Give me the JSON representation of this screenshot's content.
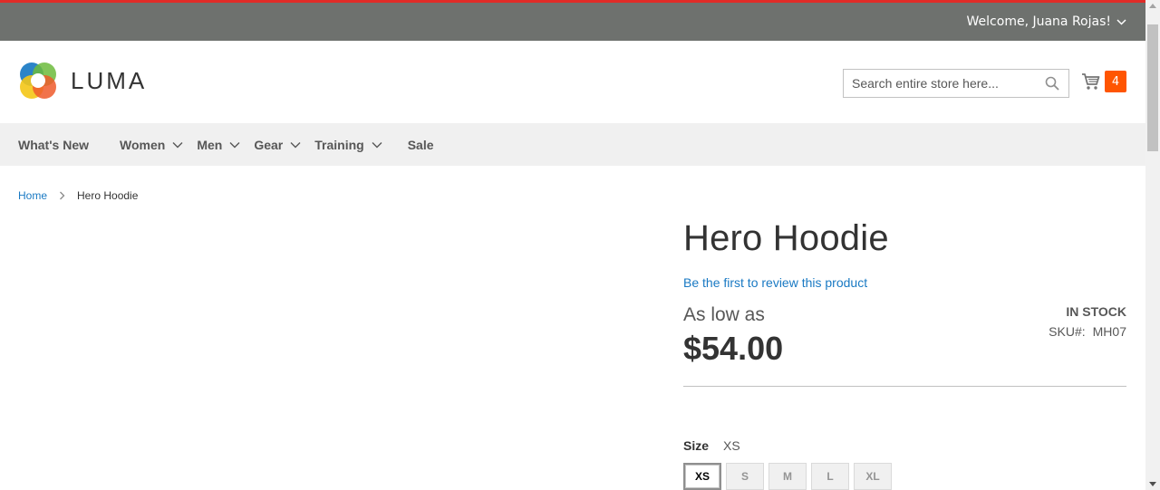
{
  "colors": {
    "accent": "#e02b27",
    "link": "#1979c3",
    "cart_badge": "#ff5501",
    "panel": "#6e716e"
  },
  "header": {
    "welcome": "Welcome, Juana Rojas!",
    "logo_text": "LUMA",
    "search_placeholder": "Search entire store here...",
    "cart_count": "4",
    "icons": {
      "account_toggle": "chevron-down-icon",
      "search": "search-icon",
      "cart": "cart-icon"
    }
  },
  "nav": {
    "items": [
      {
        "label": "What's New",
        "has_submenu": false
      },
      {
        "label": "Women",
        "has_submenu": true
      },
      {
        "label": "Men",
        "has_submenu": true
      },
      {
        "label": "Gear",
        "has_submenu": true
      },
      {
        "label": "Training",
        "has_submenu": true
      },
      {
        "label": "Sale",
        "has_submenu": false
      }
    ]
  },
  "breadcrumbs": {
    "home": "Home",
    "current": "Hero Hoodie"
  },
  "product": {
    "title": "Hero Hoodie",
    "review_link": "Be the first to review this product",
    "price_prefix": "As low as",
    "price": "$54.00",
    "stock_status": "IN STOCK",
    "sku_label": "SKU#:",
    "sku_value": "MH07",
    "size_label": "Size",
    "size_selected": "XS",
    "sizes": [
      "XS",
      "S",
      "M",
      "L",
      "XL"
    ]
  }
}
